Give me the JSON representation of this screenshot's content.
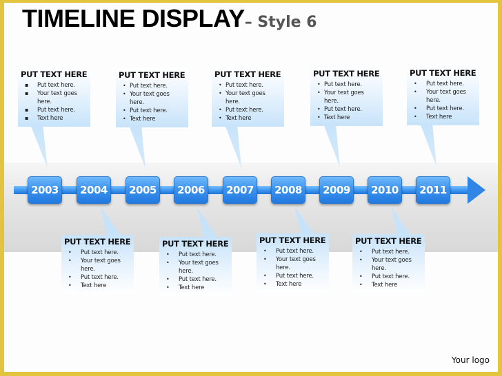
{
  "title": {
    "main": "TIMELINE DISPLAY",
    "sub": "– Style 6"
  },
  "years": [
    "2003",
    "2004",
    "2005",
    "2006",
    "2007",
    "2008",
    "2009",
    "2010",
    "2011"
  ],
  "top_callouts": [
    {
      "year": "2003",
      "heading": "PUT TEXT HERE",
      "bullets": [
        "Put text here.",
        "Your text goes here.",
        "Put text here.",
        "Text here"
      ]
    },
    {
      "year": "2005",
      "heading": "PUT TEXT HERE",
      "bullets": [
        "Put text here.",
        "Your text goes here.",
        "Put text here.",
        "Text here"
      ]
    },
    {
      "year": "2007",
      "heading": "PUT TEXT HERE",
      "bullets": [
        "Put text here.",
        "Your text goes here.",
        "Put text here.",
        "Text here"
      ]
    },
    {
      "year": "2009",
      "heading": "PUT TEXT HERE",
      "bullets": [
        "Put text here.",
        "Your text goes here.",
        "Put text here.",
        "Text here"
      ]
    },
    {
      "year": "2011",
      "heading": "PUT TEXT HERE",
      "bullets": [
        "Put text here.",
        "Your text goes here.",
        "Put text here.",
        "Text here"
      ]
    }
  ],
  "bottom_callouts": [
    {
      "year": "2004",
      "heading": "PUT TEXT HERE",
      "bullets": [
        "Put text here.",
        "Your text goes here.",
        "Put text here.",
        "Text here"
      ]
    },
    {
      "year": "2006",
      "heading": "PUT TEXT HERE",
      "bullets": [
        "Put text here.",
        "Your text goes here.",
        "Put text here.",
        "Text here"
      ]
    },
    {
      "year": "2008",
      "heading": "PUT TEXT HERE",
      "bullets": [
        "Put text here.",
        "Your text goes here.",
        "Put text here.",
        "Text here"
      ]
    },
    {
      "year": "2010",
      "heading": "PUT TEXT HERE",
      "bullets": [
        "Put text here.",
        "Your text goes here.",
        "Put text here.",
        "Text here"
      ]
    }
  ],
  "footer": {
    "logo": "Your logo"
  },
  "colors": {
    "border": "#e2c43e",
    "year_box": "#3d94ee",
    "callout": "#c7e3fa"
  }
}
